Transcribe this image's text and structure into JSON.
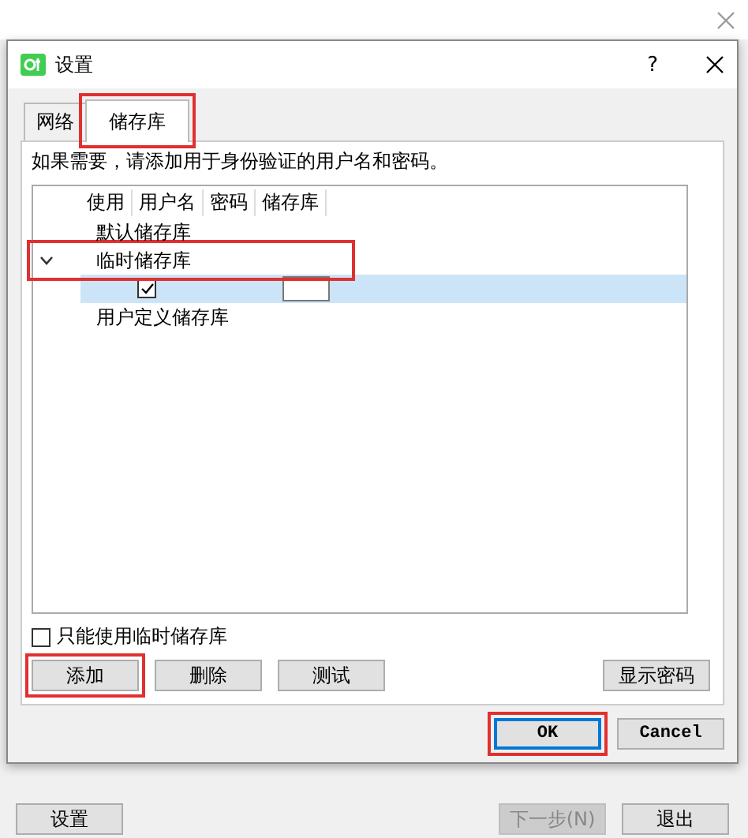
{
  "dialog": {
    "title": "设置",
    "help": "?"
  },
  "tabs": [
    {
      "label": "网络",
      "selected": false,
      "highlighted": false
    },
    {
      "label": "储存库",
      "selected": true,
      "highlighted": true
    }
  ],
  "hint": "如果需要，请添加用于身份验证的用户名和密码。",
  "tree": {
    "columns": [
      "使用",
      "用户名",
      "密码",
      "储存库"
    ],
    "items": [
      {
        "label": "默认储存库",
        "highlighted": false
      },
      {
        "label": "临时储存库",
        "expanded": true,
        "highlighted": true,
        "children": [
          {
            "kind": "credential",
            "checked": true,
            "selected": true
          }
        ]
      },
      {
        "label": "用户定义储存库",
        "highlighted": false
      }
    ]
  },
  "option": {
    "label": "只能使用临时储存库",
    "checked": false
  },
  "left_buttons": [
    {
      "label": "添加",
      "highlighted": true
    },
    {
      "label": "删除",
      "highlighted": false
    },
    {
      "label": "测试",
      "highlighted": false
    }
  ],
  "right_buttons": [
    {
      "label": "显示密码",
      "highlighted": false
    }
  ],
  "dialog_buttons": [
    {
      "label": "OK",
      "default": true,
      "highlighted": true
    },
    {
      "label": "Cancel",
      "default": false,
      "highlighted": false
    }
  ],
  "footer": {
    "left_buttons": [
      {
        "label": "设置",
        "disabled": false
      }
    ],
    "right_buttons": [
      {
        "label": "下一步(N)",
        "disabled": true
      },
      {
        "label": "退出",
        "disabled": false
      }
    ]
  }
}
